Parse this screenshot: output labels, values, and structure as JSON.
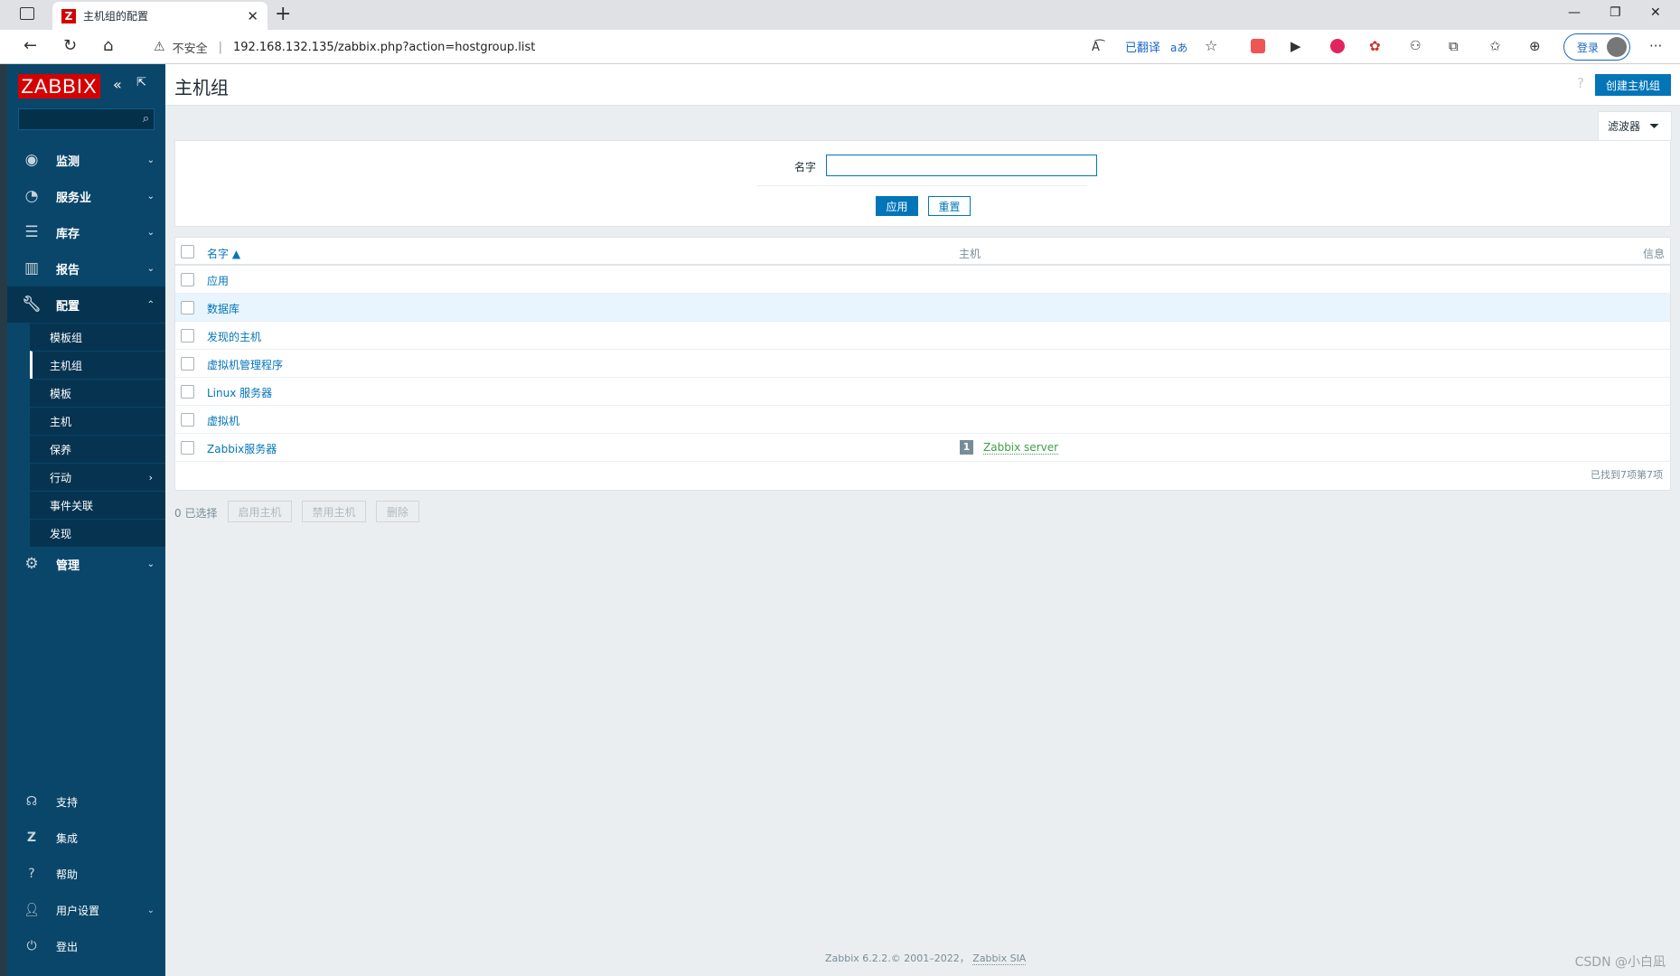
{
  "browser": {
    "tab_title": "主机组的配置",
    "favicon_letter": "Z",
    "insecure_label": "不安全",
    "url": "192.168.132.135/zabbix.php?action=hostgroup.list",
    "translated_label": "已翻译",
    "login_label": "登录"
  },
  "sidebar": {
    "logo": "ZABBIX",
    "menu": [
      {
        "label": "监测",
        "icon": "eye-icon"
      },
      {
        "label": "服务业",
        "icon": "clock-icon"
      },
      {
        "label": "库存",
        "icon": "list-icon"
      },
      {
        "label": "报告",
        "icon": "report-icon"
      },
      {
        "label": "配置",
        "icon": "wrench-icon"
      }
    ],
    "submenu": [
      "模板组",
      "主机组",
      "模板",
      "主机",
      "保养",
      "行动",
      "事件关联",
      "发现"
    ],
    "admin": "管理",
    "bottom": [
      {
        "label": "支持",
        "icon": "headset-icon"
      },
      {
        "label": "集成",
        "icon": "zabbix-icon"
      },
      {
        "label": "帮助",
        "icon": "help-icon"
      },
      {
        "label": "用户设置",
        "icon": "user-icon"
      },
      {
        "label": "登出",
        "icon": "power-icon"
      }
    ]
  },
  "header": {
    "title": "主机组",
    "help": "?",
    "create_button": "创建主机组"
  },
  "filter": {
    "tab_label": "滤波器",
    "name_label": "名字",
    "name_value": "",
    "apply": "应用",
    "reset": "重置"
  },
  "table": {
    "columns": {
      "name": "名字 ▲",
      "hosts": "主机",
      "info": "信息"
    },
    "rows": [
      {
        "name": "应用",
        "count": "",
        "host": ""
      },
      {
        "name": "数据库",
        "count": "",
        "host": ""
      },
      {
        "name": "发现的主机",
        "count": "",
        "host": ""
      },
      {
        "name": "虚拟机管理程序",
        "count": "",
        "host": ""
      },
      {
        "name": "Linux 服务器",
        "count": "",
        "host": ""
      },
      {
        "name": "虚拟机",
        "count": "",
        "host": ""
      },
      {
        "name": "Zabbix服务器",
        "count": "1",
        "host": "Zabbix server"
      }
    ],
    "found": "已找到7项第7项"
  },
  "actions": {
    "selected": "0 已选择",
    "enable": "启用主机",
    "disable": "禁用主机",
    "delete": "删除"
  },
  "footer": {
    "text": "Zabbix 6.2.2.© 2001–2022，",
    "link": "Zabbix SIA"
  },
  "watermark": "CSDN @小白凪"
}
